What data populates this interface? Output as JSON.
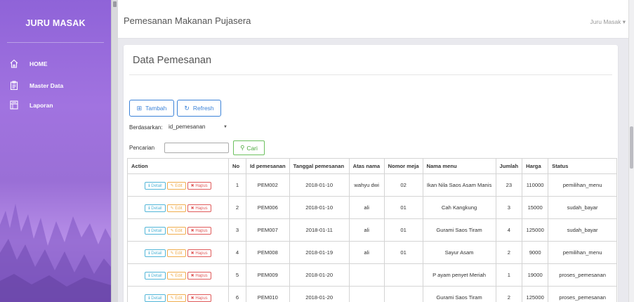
{
  "sidebar": {
    "brand": "JURU MASAK",
    "items": [
      {
        "label": "HOME",
        "icon": "home-icon"
      },
      {
        "label": "Master Data",
        "icon": "clipboard-icon"
      },
      {
        "label": "Laporan",
        "icon": "report-icon"
      }
    ]
  },
  "header": {
    "title": "Pemesanan Makanan Pujasera",
    "user": "Juru Masak ▾"
  },
  "main": {
    "title": "Data Pemesanan",
    "add_label": "Tambah",
    "refresh_label": "Refresh",
    "filter_label": "Berdasarkan:",
    "filter_value": "id_pemesanan",
    "search_label": "Pencarian",
    "search_value": "",
    "search_button": "Cari"
  },
  "table": {
    "headers": [
      "Action",
      "No",
      "Id pemesanan",
      "Tanggal pemesanan",
      "Atas nama",
      "Nomor meja",
      "Nama menu",
      "Jumlah",
      "Harga",
      "Status"
    ],
    "action_labels": {
      "detail": "ℹ Detail",
      "edit": "✎ Edit",
      "delete": "✖ Hapus"
    },
    "rows": [
      {
        "no": "1",
        "id": "PEM002",
        "tanggal": "2018-01-10",
        "atas_nama": "wahyu dwi",
        "meja": "02",
        "menu": "Ikan Nila Saos Asam Manis",
        "jumlah": "23",
        "harga": "110000",
        "status": "pemilihan_menu"
      },
      {
        "no": "2",
        "id": "PEM006",
        "tanggal": "2018-01-10",
        "atas_nama": "ali",
        "meja": "01",
        "menu": "Cah Kangkung",
        "jumlah": "3",
        "harga": "15000",
        "status": "sudah_bayar"
      },
      {
        "no": "3",
        "id": "PEM007",
        "tanggal": "2018-01-11",
        "atas_nama": "ali",
        "meja": "01",
        "menu": "Gurami Saos Tiram",
        "jumlah": "4",
        "harga": "125000",
        "status": "sudah_bayar"
      },
      {
        "no": "4",
        "id": "PEM008",
        "tanggal": "2018-01-19",
        "atas_nama": "ali",
        "meja": "01",
        "menu": "Sayur Asam",
        "jumlah": "2",
        "harga": "9000",
        "status": "pemilihan_menu"
      },
      {
        "no": "5",
        "id": "PEM009",
        "tanggal": "2018-01-20",
        "atas_nama": "",
        "meja": "",
        "menu": "P ayam penyet Meriah",
        "jumlah": "1",
        "harga": "19000",
        "status": "proses_pemesanan"
      },
      {
        "no": "6",
        "id": "PEM010",
        "tanggal": "2018-01-20",
        "atas_nama": "",
        "meja": "",
        "menu": "Gurami Saos Tiram",
        "jumlah": "2",
        "harga": "125000",
        "status": "proses_pemesanan"
      }
    ]
  },
  "colors": {
    "sidebar": "#9b6fdc",
    "primary": "#3b82d8",
    "success": "#4aa83b",
    "info": "#52b6d8",
    "warning": "#f0ad4e",
    "danger": "#e05a5a"
  }
}
